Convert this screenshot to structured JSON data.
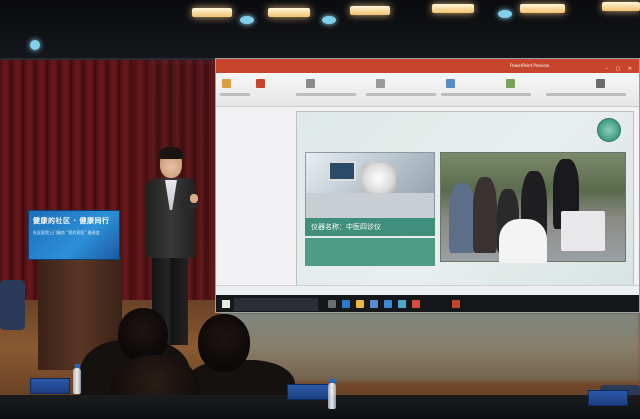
{
  "podium": {
    "title": "健康的社区 · 健康同行",
    "subtitle": "社区医院上门服务 “签约家医” 推进会"
  },
  "projection": {
    "titlebar_left": "",
    "titlebar_center": "",
    "titlebar_right": "PowerPoint Preview",
    "slide": {
      "label": "仪器名称：中医四诊仪",
      "description": "",
      "statusbar": ""
    },
    "taskbar_search": ""
  },
  "audience": {
    "nametag_left": "",
    "nametag_mid": "",
    "nametag_right": ""
  }
}
